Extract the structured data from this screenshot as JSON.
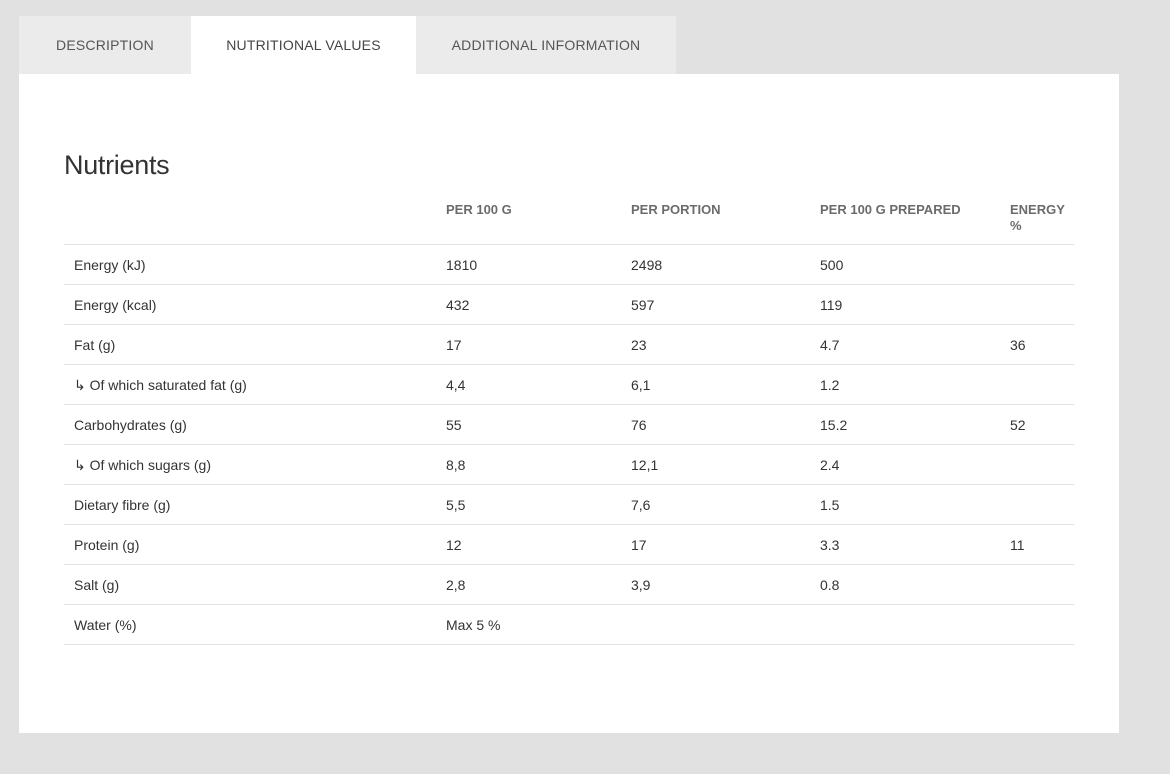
{
  "tabs": [
    {
      "label": "DESCRIPTION",
      "active": false
    },
    {
      "label": "NUTRITIONAL VALUES",
      "active": true
    },
    {
      "label": "ADDITIONAL INFORMATION",
      "active": false
    }
  ],
  "section": {
    "title": "Nutrients"
  },
  "table": {
    "headers": [
      "",
      "PER 100 G",
      "PER PORTION",
      "PER 100 G PREPARED",
      "ENERGY %"
    ],
    "rows": [
      [
        "Energy (kJ)",
        "1810",
        "2498",
        "500",
        ""
      ],
      [
        "Energy (kcal)",
        "432",
        "597",
        "119",
        ""
      ],
      [
        "Fat (g)",
        "17",
        "23",
        "4.7",
        "36"
      ],
      [
        "↳ Of which saturated fat (g)",
        "4,4",
        "6,1",
        "1.2",
        ""
      ],
      [
        "Carbohydrates (g)",
        "55",
        "76",
        "15.2",
        "52"
      ],
      [
        "↳ Of which sugars (g)",
        "8,8",
        "12,1",
        "2.4",
        ""
      ],
      [
        "Dietary fibre (g)",
        "5,5",
        "7,6",
        "1.5",
        ""
      ],
      [
        "Protein (g)",
        "12",
        "17",
        "3.3",
        "11"
      ],
      [
        "Salt (g)",
        "2,8",
        "3,9",
        "0.8",
        ""
      ],
      [
        "Water (%)",
        "Max 5 %",
        "",
        "",
        ""
      ]
    ]
  },
  "colors": {
    "page_background": "#e1e1e1",
    "tab_inactive": "#ebebeb",
    "tab_active": "#ffffff",
    "panel": "#ffffff",
    "row_border": "#e3e3e3",
    "header_text": "#6b6b6b",
    "body_text": "#333333"
  }
}
